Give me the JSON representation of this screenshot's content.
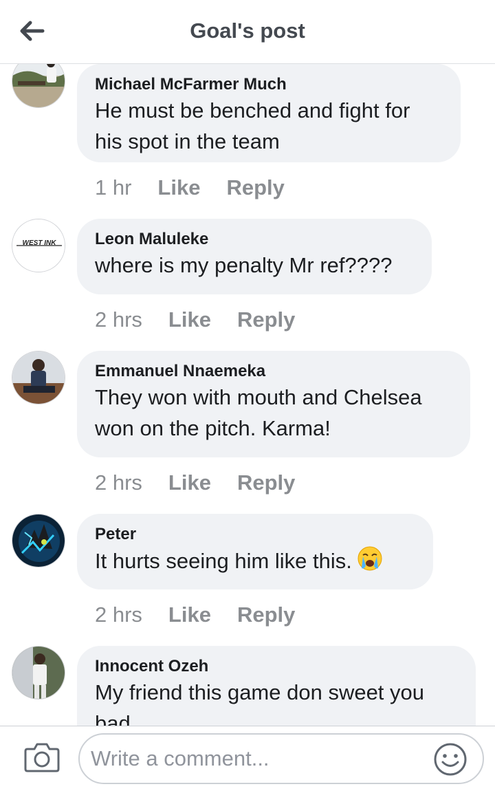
{
  "header": {
    "title": "Goal's post",
    "back_icon": "arrow-left-icon"
  },
  "comments": [
    {
      "author": "Michael McFarmer Much",
      "text": "He must be benched and fight for his spot in the team",
      "time": "1 hr",
      "like": "Like",
      "reply": "Reply"
    },
    {
      "author": "Leon Maluleke",
      "avatar_label": "WEST INK",
      "text": "where is my penalty Mr ref????",
      "time": "2 hrs",
      "like": "Like",
      "reply": "Reply"
    },
    {
      "author": "Emmanuel Nnaemeka",
      "text": "They won with mouth and Chelsea won on the pitch. Karma!",
      "time": "2 hrs",
      "like": "Like",
      "reply": "Reply"
    },
    {
      "author": "Peter",
      "text": "It hurts seeing him like this.",
      "emoji": "loudly-crying-face-emoji",
      "time": "2 hrs",
      "like": "Like",
      "reply": "Reply"
    },
    {
      "author": "Innocent Ozeh",
      "text": "My friend this game don sweet you bad"
    }
  ],
  "composer": {
    "placeholder": "Write a comment...",
    "value": "",
    "camera_icon": "camera-icon",
    "emoji_icon": "smiley-icon"
  },
  "colors": {
    "bubble": "#f0f2f5",
    "meta_text": "#8a8d91",
    "title": "#444950",
    "border": "#ccd0d5"
  }
}
